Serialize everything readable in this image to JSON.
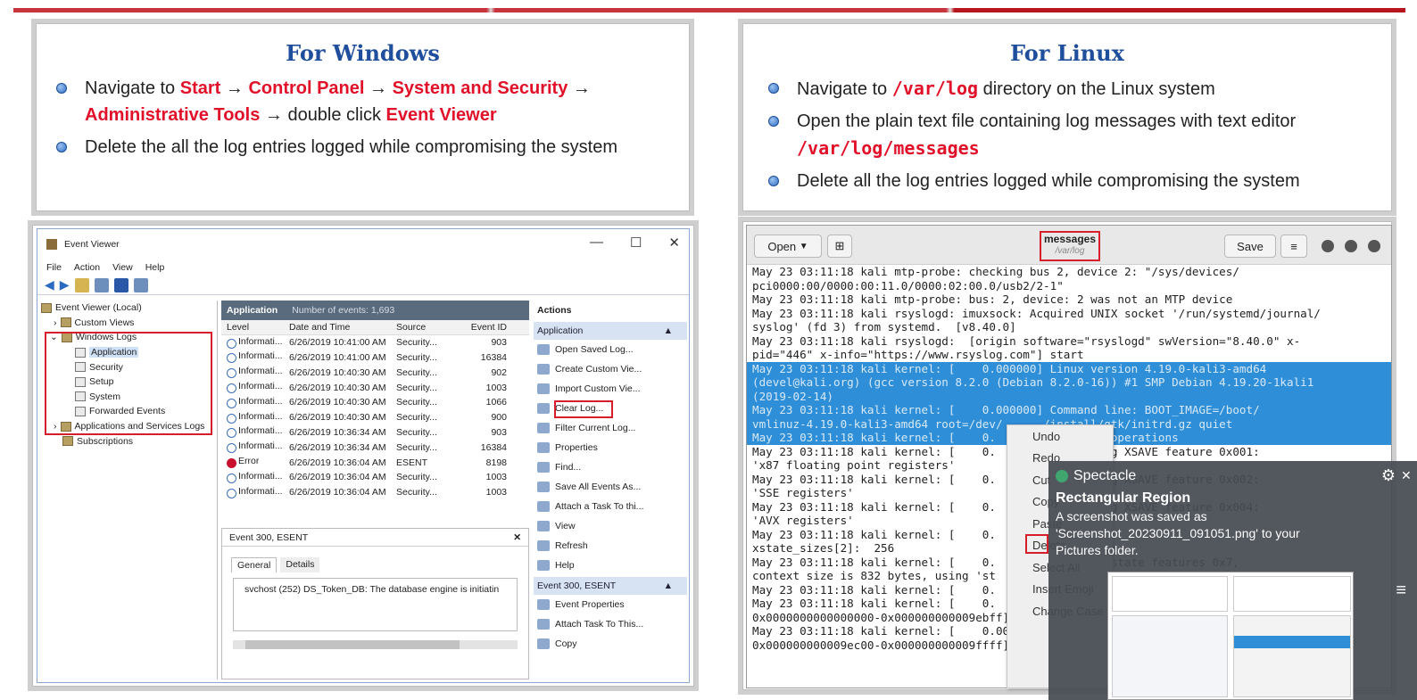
{
  "windows_panel": {
    "title": "For Windows",
    "b1_a": "Navigate to ",
    "b1_start": "Start",
    "b1_arrow1": " → ",
    "b1_cp": "Control Panel",
    "b1_arrow2": " → ",
    "b1_sys": "System and Security",
    "b1_arrow3": " → ",
    "b1_admin": "Administrative Tools",
    "b1_arrow4": " → double click ",
    "b1_ev": "Event Viewer",
    "b2": "Delete the all the log entries logged while compromising the system"
  },
  "linux_panel": {
    "title": "For Linux",
    "b1_a": "Navigate to ",
    "b1_path": "/var/log",
    "b1_b": " directory on the Linux system",
    "b2_a": "Open the plain text file containing log messages with text editor ",
    "b2_path": "/var/log/messages",
    "b3": "Delete all the log entries logged while compromising the system"
  },
  "event_viewer": {
    "window_title": "Event Viewer",
    "menu": [
      "File",
      "Action",
      "View",
      "Help"
    ],
    "tree": [
      "Event Viewer (Local)",
      "Custom Views",
      "Windows Logs",
      "Application",
      "Security",
      "Setup",
      "System",
      "Forwarded Events",
      "Applications and Services Logs",
      "Subscriptions"
    ],
    "header_title": "Application",
    "header_count": "Number of events: 1,693",
    "columns": [
      "Level",
      "Date and Time",
      "Source",
      "Event ID"
    ],
    "rows": [
      [
        "Informati...",
        "6/26/2019 10:41:00 AM",
        "Security...",
        "903",
        "i"
      ],
      [
        "Informati...",
        "6/26/2019 10:41:00 AM",
        "Security...",
        "16384",
        "i"
      ],
      [
        "Informati...",
        "6/26/2019 10:40:30 AM",
        "Security...",
        "902",
        "i"
      ],
      [
        "Informati...",
        "6/26/2019 10:40:30 AM",
        "Security...",
        "1003",
        "i"
      ],
      [
        "Informati...",
        "6/26/2019 10:40:30 AM",
        "Security...",
        "1066",
        "i"
      ],
      [
        "Informati...",
        "6/26/2019 10:40:30 AM",
        "Security...",
        "900",
        "i"
      ],
      [
        "Informati...",
        "6/26/2019 10:36:34 AM",
        "Security...",
        "903",
        "i"
      ],
      [
        "Informati...",
        "6/26/2019 10:36:34 AM",
        "Security...",
        "16384",
        "i"
      ],
      [
        "Error",
        "6/26/2019 10:36:04 AM",
        "ESENT",
        "8198",
        "e"
      ],
      [
        "Informati...",
        "6/26/2019 10:36:04 AM",
        "Security...",
        "1003",
        "i"
      ],
      [
        "Informati...",
        "6/26/2019 10:36:04 AM",
        "Security...",
        "1003",
        "i"
      ]
    ],
    "detail_title": "Event 300, ESENT",
    "detail_tabs": [
      "General",
      "Details"
    ],
    "detail_text": "svchost (252) DS_Token_DB: The database engine is initiatin",
    "actions_title": "Actions",
    "actions_sec1": "Application",
    "actions": [
      "Open Saved Log...",
      "Create Custom Vie...",
      "Import Custom Vie...",
      "Clear Log...",
      "Filter Current Log...",
      "Properties",
      "Find...",
      "Save All Events As...",
      "Attach a Task To thi...",
      "View",
      "Refresh",
      "Help"
    ],
    "actions_sec2": "Event 300, ESENT",
    "actions2": [
      "Event Properties",
      "Attach Task To This...",
      "Copy"
    ]
  },
  "gedit": {
    "open_label": "Open",
    "title": "messages",
    "subtitle": "/var/log",
    "save_label": "Save",
    "lines": [
      "May 23 03:11:18 kali mtp-probe: checking bus 2, device 2: \"/sys/devices/",
      "pci0000:00/0000:00:11.0/0000:02:00.0/usb2/2-1\"",
      "May 23 03:11:18 kali mtp-probe: bus: 2, device: 2 was not an MTP device",
      "May 23 03:11:18 kali rsyslogd: imuxsock: Acquired UNIX socket '/run/systemd/journal/",
      "syslog' (fd 3) from systemd.  [v8.40.0]",
      "May 23 03:11:18 kali rsyslogd:  [origin software=\"rsyslogd\" swVersion=\"8.40.0\" x-",
      "pid=\"446\" x-info=\"https://www.rsyslog.com\"] start"
    ],
    "selected": [
      "May 23 03:11:18 kali kernel: [    0.000000] Linux version 4.19.0-kali3-amd64",
      "(devel@kali.org) (gcc version 8.2.0 (Debian 8.2.0-16)) #1 SMP Debian 4.19.20-1kali1",
      "(2019-02-14)",
      "May 23 03:11:18 kali kernel: [    0.000000] Command line: BOOT_IMAGE=/boot/",
      "vmlinuz-4.19.0-kali3-amd64 root=/dev/      /install/gtk/initrd.gz quiet",
      "May 23 03:11:18 kali kernel: [    0.       st string operations"
    ],
    "after": [
      "May 23 03:11:18 kali kernel: [    0.          pporting XSAVE feature 0x001:",
      "'x87 floating point registers'",
      "May 23 03:11:18 kali kernel: [    0.          pporting XSAVE feature 0x002:",
      "'SSE registers'",
      "May 23 03:11:18 kali kernel: [    0.          pporting XSAVE feature 0x004:",
      "'AVX registers'",
      "May 23 03:11:18 kali kernel: [    0.          ",
      "xstate_sizes[2]:  256",
      "May 23 03:11:18 kali kernel: [    0.          abled xstate features 0x7,",
      "context size is 832 bytes, using 'st",
      "May 23 03:11:18 kali kernel: [    0.",
      "May 23 03:11:18 kali kernel: [    0.",
      "0x0000000000000000-0x000000000009ebff] usable",
      "May 23 03:11:18 kali kernel: [    0.000000] BIOS-e",
      "0x000000000009ec00-0x000000000009ffff] reserved"
    ],
    "context_menu": [
      "Undo",
      "Redo",
      "Cut",
      "Copy",
      "Paste",
      "Delete",
      "Select All",
      "Insert Emoji",
      "Change Case"
    ]
  },
  "spectacle": {
    "app": "Spectacle",
    "heading": "Rectangular Region",
    "message": "A screenshot was saved as 'Screenshot_20230911_091051.png' to your Pictures folder."
  }
}
